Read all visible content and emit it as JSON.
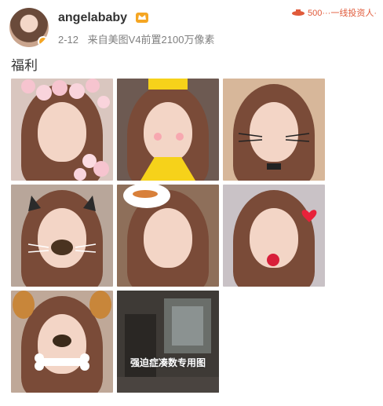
{
  "post": {
    "username": "angelababy",
    "date": "2-12",
    "source": "来自美图V4前置2100万像素",
    "text": "福利"
  },
  "watermark": {
    "text": "500···一线投资人·"
  },
  "images": [
    {
      "name": "flower-crown-selfie",
      "bg": "#d9c6bf",
      "effect": "flowers"
    },
    {
      "name": "yellow-costume-selfie",
      "bg": "#6d5a52",
      "effect": "yellow"
    },
    {
      "name": "cat-whiskers-selfie",
      "bg": "#d7b79a",
      "effect": "whiskers"
    },
    {
      "name": "dog-nose-selfie",
      "bg": "#b8a69a",
      "effect": "dog"
    },
    {
      "name": "hotdog-selfie",
      "bg": "#8e6f5a",
      "effect": "hotdog"
    },
    {
      "name": "hearts-selfie",
      "bg": "#c9c2c6",
      "effect": "hearts"
    },
    {
      "name": "puppy-bone-selfie",
      "bg": "#bfa898",
      "effect": "puppy"
    },
    {
      "name": "obsessive-compulsive-image",
      "bg": "#403d3a",
      "effect": "text"
    }
  ],
  "caption_image_8": "强迫症凑数专用图",
  "colors": {
    "meta_gray": "#808080",
    "accent_orange": "#e05a3a",
    "badge_gold": "#f5a623"
  }
}
